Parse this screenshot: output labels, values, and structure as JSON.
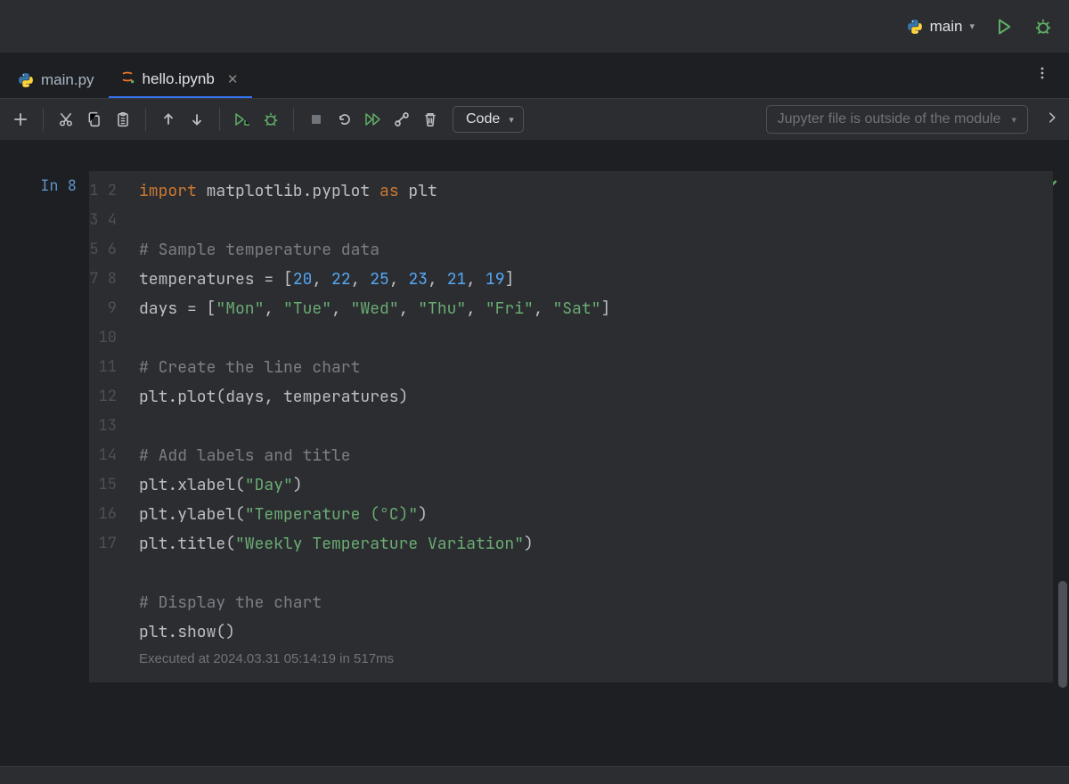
{
  "header": {
    "run_config_label": "main"
  },
  "tabs": [
    {
      "label": "main.py",
      "icon": "python"
    },
    {
      "label": "hello.ipynb",
      "icon": "jupyter",
      "active": true
    }
  ],
  "toolbar": {
    "cell_type": "Code",
    "notice": "Jupyter file is outside of the module"
  },
  "cell": {
    "prompt_label": "In",
    "prompt_count": "8",
    "line_count": 17,
    "code": {
      "l1": {
        "kw1": "import",
        "mod": "matplotlib.pyplot",
        "kw2": "as",
        "alias": "plt"
      },
      "l3_comment": "# Sample temperature data",
      "l4": {
        "var": "temperatures = [",
        "n1": "20",
        "c1": ", ",
        "n2": "22",
        "c2": ", ",
        "n3": "25",
        "c3": ", ",
        "n4": "23",
        "c4": ", ",
        "n5": "21",
        "c5": ", ",
        "n6": "19",
        "end": "]"
      },
      "l5": {
        "var": "days = [",
        "s1": "\"Mon\"",
        "c1": ", ",
        "s2": "\"Tue\"",
        "c2": ", ",
        "s3": "\"Wed\"",
        "c3": ", ",
        "s4": "\"Thu\"",
        "c4": ", ",
        "s5": "\"Fri\"",
        "c5": ", ",
        "s6": "\"Sat\"",
        "end": "]"
      },
      "l7_comment": "# Create the line chart",
      "l8": "plt.plot(days, temperatures)",
      "l10_comment": "# Add labels and title",
      "l11": {
        "a": "plt.xlabel(",
        "s": "\"Day\"",
        "b": ")"
      },
      "l12": {
        "a": "plt.ylabel(",
        "s": "\"Temperature (°C)\"",
        "b": ")"
      },
      "l13": {
        "a": "plt.title(",
        "s": "\"Weekly Temperature Variation\"",
        "b": ")"
      },
      "l15_comment": "# Display the chart",
      "l16": "plt.show()"
    },
    "exec_info": "Executed at 2024.03.31 05:14:19 in 517ms"
  }
}
